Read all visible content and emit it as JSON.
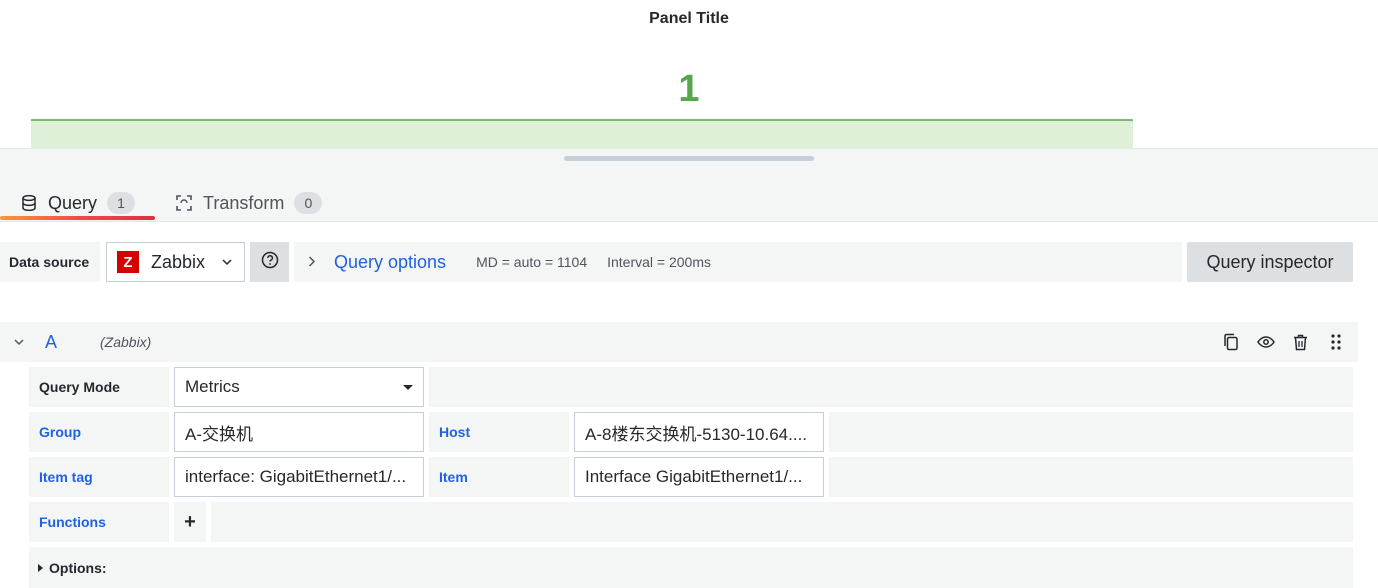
{
  "panel": {
    "title": "Panel Title",
    "value": "1",
    "value_color": "#56a64b",
    "sparkline_fill": "#dff0d8"
  },
  "tabs": [
    {
      "label": "Query",
      "count": "1",
      "icon": "database-icon",
      "active": true
    },
    {
      "label": "Transform",
      "count": "0",
      "icon": "transform-icon",
      "active": false
    }
  ],
  "datasource": {
    "label": "Data source",
    "selected": "Zabbix",
    "logo_letter": "Z",
    "query_options_label": "Query options",
    "md_text": "MD = auto = 1104",
    "interval_text": "Interval = 200ms",
    "inspector_label": "Query inspector"
  },
  "query": {
    "ref_id": "A",
    "datasource_name": "(Zabbix)",
    "query_mode_label": "Query Mode",
    "query_mode_value": "Metrics",
    "group_label": "Group",
    "group_value": "A-交换机",
    "host_label": "Host",
    "host_value": "A-8楼东交换机-5130-10.64....",
    "item_tag_label": "Item tag",
    "item_tag_value": "interface: GigabitEthernet1/...",
    "item_label": "Item",
    "item_value": "Interface GigabitEthernet1/...",
    "functions_label": "Functions",
    "add_function": "+",
    "options_label": "Options:"
  },
  "colors": {
    "accent_blue": "#1f62e0",
    "zabbix_red": "#d40000"
  }
}
